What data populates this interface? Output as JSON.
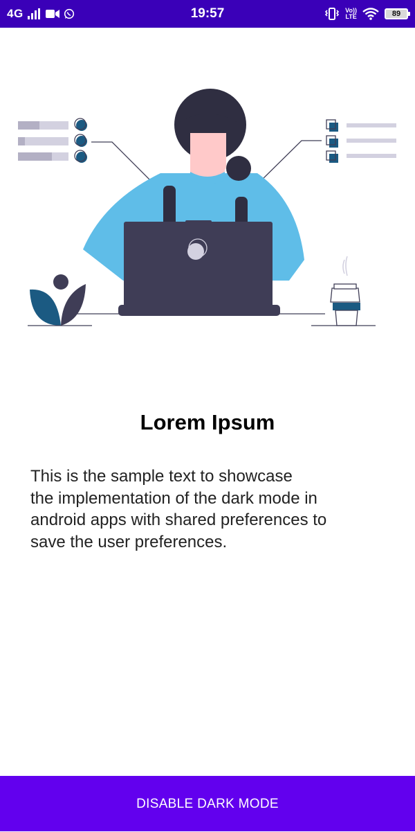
{
  "status_bar": {
    "network": "4G",
    "time": "19:57",
    "volte_top": "Vo))",
    "volte_bottom": "LTE",
    "battery": "89"
  },
  "content": {
    "title": "Lorem Ipsum",
    "body_lines": [
      "This is the sample text to showcase",
      "the implementation of the dark mode in",
      "android apps with shared preferences to",
      "save the user preferences."
    ]
  },
  "action_button": {
    "label": "DISABLE DARK MODE"
  },
  "colors": {
    "status_bar": "#3a00b8",
    "button": "#6200ee",
    "illustration_accent": "#1b5a82",
    "shirt": "#5fbde8",
    "laptop": "#3f3d56"
  }
}
